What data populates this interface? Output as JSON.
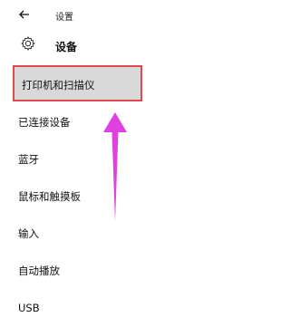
{
  "window": {
    "title": "设置",
    "back_icon": "back-arrow-icon"
  },
  "header": {
    "icon": "gear-icon",
    "title": "设备"
  },
  "nav": {
    "items": [
      {
        "label": "打印机和扫描仪",
        "selected": true
      },
      {
        "label": "已连接设备",
        "selected": false
      },
      {
        "label": "蓝牙",
        "selected": false
      },
      {
        "label": "鼠标和触摸板",
        "selected": false
      },
      {
        "label": "输入",
        "selected": false
      },
      {
        "label": "自动播放",
        "selected": false
      },
      {
        "label": "USB",
        "selected": false
      }
    ]
  },
  "colors": {
    "selection_bg": "#d9d9d9",
    "highlight_border": "#e24a4a",
    "annotation_arrow": "#e040e0"
  },
  "annotation": {
    "type": "arrow",
    "direction": "up",
    "icon": "up-arrow-annotation"
  }
}
